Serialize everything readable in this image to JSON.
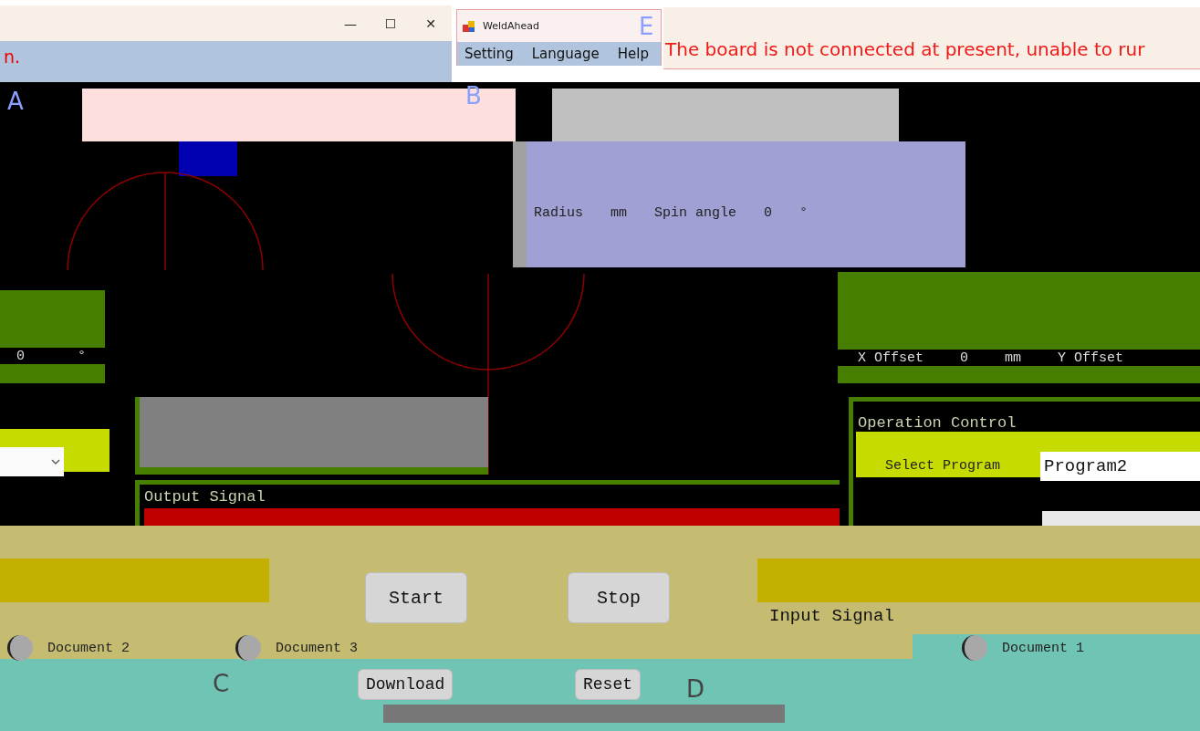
{
  "background_window": {
    "status_text": "n.",
    "window_controls": [
      "—",
      "☐",
      "✕"
    ]
  },
  "weldahead_window": {
    "title": "WeldAhead",
    "menu": [
      "Setting",
      "Language",
      "Help"
    ],
    "status_message": "The board is not connected at present, unable to rur"
  },
  "markers": [
    "A",
    "B",
    "C",
    "D",
    "E"
  ],
  "shape_panel": {
    "fields": [
      {
        "label": "Radius",
        "unit": "mm"
      },
      {
        "label": "Spin angle",
        "value": "0",
        "unit": "°"
      }
    ]
  },
  "angle_panel": {
    "value": "0",
    "unit": "°"
  },
  "offset_panel": {
    "fields": [
      {
        "label": "X Offset",
        "value": "0",
        "unit": "mm"
      },
      {
        "label": "Y Offset"
      }
    ]
  },
  "operation_control": {
    "title": "Operation Control",
    "select_label": "Select Program",
    "program": "Program2"
  },
  "output_signal": {
    "title": "Output Signal"
  },
  "input_signal": {
    "title": "Input Signal"
  },
  "buttons": [
    {
      "label": "Start",
      "kind": "large"
    },
    {
      "label": "Stop",
      "kind": "large"
    },
    {
      "label": "Download",
      "kind": "small"
    },
    {
      "label": "Reset",
      "kind": "small"
    }
  ],
  "documents": [
    {
      "label": "Document 2",
      "selected": false
    },
    {
      "label": "Document 3",
      "selected": false
    },
    {
      "label": "Document 1",
      "selected": false
    }
  ]
}
